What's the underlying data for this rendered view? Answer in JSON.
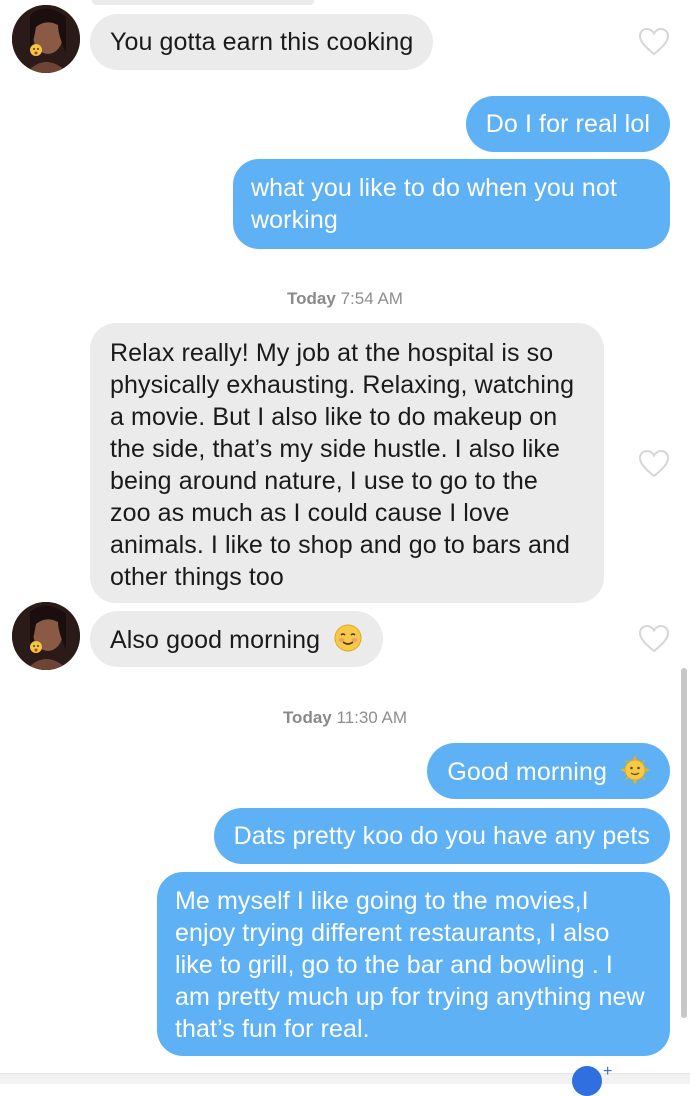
{
  "conversation": {
    "messages": [
      {
        "id": "m1",
        "from": "them",
        "text": "You gotta earn this cooking"
      },
      {
        "id": "m2",
        "from": "me",
        "text": "Do I for real lol"
      },
      {
        "id": "m3",
        "from": "me",
        "text": "what you like to do when you not working"
      },
      {
        "id": "m4",
        "from": "them",
        "text": "Relax really! My job at the hospital is so physically exhausting. Relaxing, watching a movie. But I also like to do makeup on the side, that’s my side hustle. I also like being around nature, I use to go to the zoo as much as I could cause I love animals. I like to shop and go to bars and other things too"
      },
      {
        "id": "m5",
        "from": "them",
        "text": "Also good morning",
        "emoji": "smiling-blush-emoji"
      },
      {
        "id": "m6",
        "from": "me",
        "text": "Good morning",
        "emoji": "sun-face-emoji"
      },
      {
        "id": "m7",
        "from": "me",
        "text": "Dats pretty koo  do you have any pets"
      },
      {
        "id": "m8",
        "from": "me",
        "text": "Me myself I like going to the movies,I enjoy trying different restaurants, I also like to grill, go to the bar and bowling . I am pretty much up for trying anything new that’s fun for real."
      }
    ],
    "timestamps": [
      {
        "day": "Today",
        "time": "7:54 AM"
      },
      {
        "day": "Today",
        "time": "11:30 AM"
      }
    ]
  },
  "icons": {
    "heart": "heart-outline-icon",
    "avatar": "contact-avatar"
  },
  "colors": {
    "outgoing_bubble": "#5fb1f5",
    "incoming_bubble": "#ebebeb",
    "heart_outline": "#d6d6d6",
    "timestamp_text": "#8e8e8e"
  }
}
